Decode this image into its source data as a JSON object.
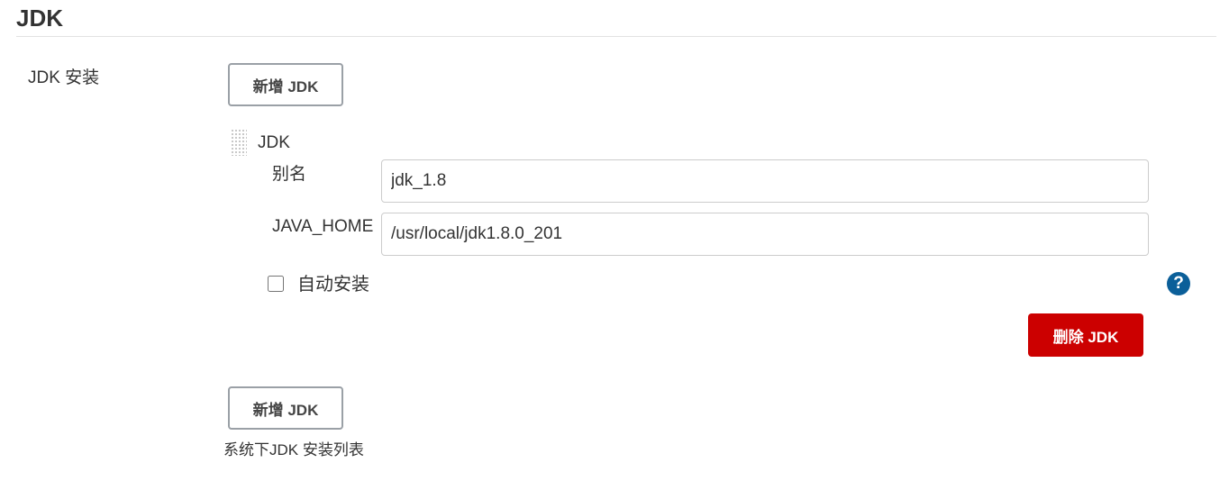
{
  "section": {
    "title": "JDK"
  },
  "jdk_installations": {
    "label": "JDK 安装",
    "add_button_label": "新增 JDK",
    "description": "系统下JDK 安装列表",
    "items": [
      {
        "title": "JDK",
        "alias_label": "别名",
        "alias_value": "jdk_1.8",
        "java_home_label": "JAVA_HOME",
        "java_home_value": "/usr/local/jdk1.8.0_201",
        "auto_install_label": "自动安装",
        "auto_install_checked": false,
        "help_icon": "question-circle-icon",
        "help_glyph": "?",
        "delete_button_label": "删除 JDK"
      }
    ]
  },
  "colors": {
    "delete_button": "#cc0000",
    "help_icon": "#0b5f99",
    "button_border": "#9aa0a6"
  }
}
